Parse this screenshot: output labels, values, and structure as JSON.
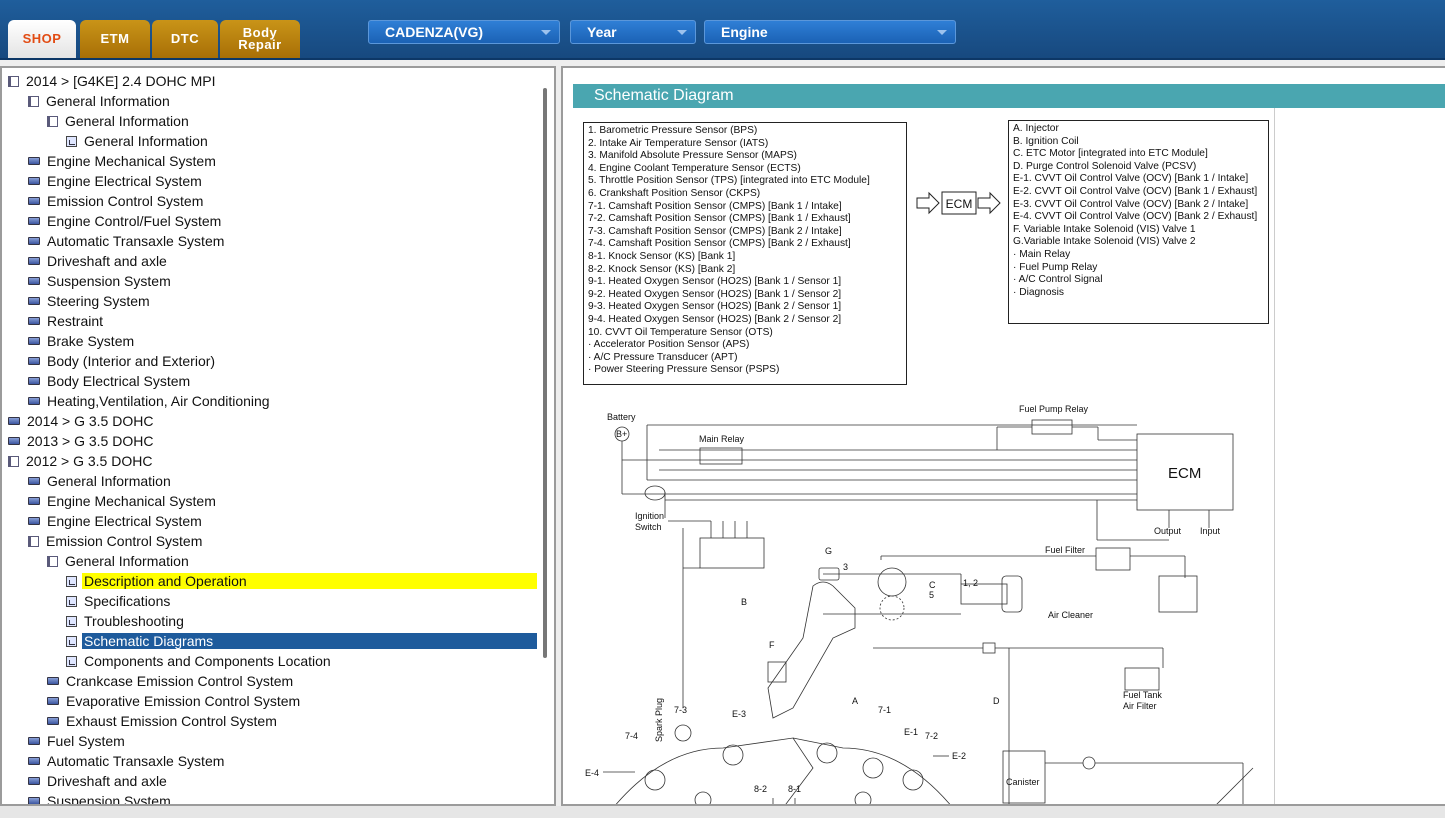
{
  "tabs": [
    {
      "label": "SHOP",
      "active": true
    },
    {
      "label": "ETM",
      "active": false
    },
    {
      "label": "DTC",
      "active": false
    },
    {
      "label": "Body\nRepair",
      "active": false
    }
  ],
  "selectors": {
    "model": "CADENZA(VG)",
    "year": "Year",
    "engine": "Engine"
  },
  "tree": [
    {
      "label": "2014 > [G4KE] 2.4 DOHC MPI",
      "icon": "book-open-icon",
      "level": 0
    },
    {
      "label": "General Information",
      "icon": "book-open-icon",
      "level": 1
    },
    {
      "label": "General Information",
      "icon": "book-open-icon",
      "level": 2
    },
    {
      "label": "General Information",
      "icon": "document-icon",
      "level": 3
    },
    {
      "label": "Engine Mechanical System",
      "icon": "book-closed-icon",
      "level": 1
    },
    {
      "label": "Engine Electrical System",
      "icon": "book-closed-icon",
      "level": 1
    },
    {
      "label": "Emission Control System",
      "icon": "book-closed-icon",
      "level": 1
    },
    {
      "label": "Engine Control/Fuel System",
      "icon": "book-closed-icon",
      "level": 1
    },
    {
      "label": "Automatic Transaxle System",
      "icon": "book-closed-icon",
      "level": 1
    },
    {
      "label": "Driveshaft and axle",
      "icon": "book-closed-icon",
      "level": 1
    },
    {
      "label": "Suspension System",
      "icon": "book-closed-icon",
      "level": 1
    },
    {
      "label": "Steering System",
      "icon": "book-closed-icon",
      "level": 1
    },
    {
      "label": "Restraint",
      "icon": "book-closed-icon",
      "level": 1
    },
    {
      "label": "Brake System",
      "icon": "book-closed-icon",
      "level": 1
    },
    {
      "label": "Body (Interior and Exterior)",
      "icon": "book-closed-icon",
      "level": 1
    },
    {
      "label": "Body Electrical System",
      "icon": "book-closed-icon",
      "level": 1
    },
    {
      "label": "Heating,Ventilation, Air Conditioning",
      "icon": "book-closed-icon",
      "level": 1
    },
    {
      "label": "2014 > G 3.5 DOHC",
      "icon": "book-closed-icon",
      "level": 0
    },
    {
      "label": "2013 > G 3.5 DOHC",
      "icon": "book-closed-icon",
      "level": 0
    },
    {
      "label": "2012 > G 3.5 DOHC",
      "icon": "book-open-icon",
      "level": 0
    },
    {
      "label": "General Information",
      "icon": "book-closed-icon",
      "level": 1
    },
    {
      "label": "Engine Mechanical System",
      "icon": "book-closed-icon",
      "level": 1
    },
    {
      "label": "Engine Electrical System",
      "icon": "book-closed-icon",
      "level": 1
    },
    {
      "label": "Emission Control System",
      "icon": "book-open-icon",
      "level": 1
    },
    {
      "label": "General Information",
      "icon": "book-open-icon",
      "level": 2
    },
    {
      "label": "Description and Operation",
      "icon": "document-icon",
      "level": 3,
      "highlight": "yellow"
    },
    {
      "label": "Specifications",
      "icon": "document-icon",
      "level": 3
    },
    {
      "label": "Troubleshooting",
      "icon": "document-icon",
      "level": 3
    },
    {
      "label": "Schematic Diagrams",
      "icon": "document-icon",
      "level": 3,
      "highlight": "selected"
    },
    {
      "label": "Components and Components Location",
      "icon": "document-icon",
      "level": 3
    },
    {
      "label": "Crankcase Emission Control System",
      "icon": "book-closed-icon",
      "level": 2
    },
    {
      "label": "Evaporative Emission Control System",
      "icon": "book-closed-icon",
      "level": 2
    },
    {
      "label": "Exhaust Emission Control System",
      "icon": "book-closed-icon",
      "level": 2
    },
    {
      "label": "Fuel System",
      "icon": "book-closed-icon",
      "level": 1
    },
    {
      "label": "Automatic Transaxle System",
      "icon": "book-closed-icon",
      "level": 1
    },
    {
      "label": "Driveshaft and axle",
      "icon": "book-closed-icon",
      "level": 1
    },
    {
      "label": "Suspension System",
      "icon": "book-closed-icon",
      "level": 1
    }
  ],
  "schematic": {
    "title": "Schematic Diagram",
    "inputs": [
      "1. Barometric Pressure Sensor (BPS)",
      "2. Intake Air Temperature Sensor (IATS)",
      "3. Manifold Absolute Pressure Sensor (MAPS)",
      "4. Engine Coolant Temperature Sensor (ECTS)",
      "5. Throttle Position Sensor (TPS) [integrated into ETC Module]",
      "6. Crankshaft Position Sensor (CKPS)",
      "7-1. Camshaft Position Sensor (CMPS) [Bank 1 / Intake]",
      "7-2. Camshaft Position Sensor (CMPS) [Bank 1 / Exhaust]",
      "7-3. Camshaft Position Sensor (CMPS) [Bank 2 / Intake]",
      "7-4. Camshaft Position Sensor (CMPS) [Bank 2 / Exhaust]",
      "8-1. Knock Sensor (KS) [Bank 1]",
      "8-2. Knock Sensor (KS) [Bank 2]",
      "9-1. Heated Oxygen Sensor (HO2S) [Bank 1 / Sensor 1]",
      "9-2. Heated Oxygen Sensor (HO2S) [Bank 1 / Sensor 2]",
      "9-3. Heated Oxygen Sensor (HO2S) [Bank 2 / Sensor 1]",
      "9-4. Heated Oxygen Sensor (HO2S) [Bank 2 / Sensor 2]",
      "10. CVVT Oil Temperature Sensor (OTS)",
      "· Accelerator Position Sensor (APS)",
      "· A/C Pressure Transducer (APT)",
      "· Power Steering Pressure Sensor (PSPS)"
    ],
    "ecm_label": "ECM",
    "outputs": [
      "A. Injector",
      "B. Ignition Coil",
      "C. ETC Motor [integrated into ETC Module]",
      "D. Purge Control Solenoid Valve (PCSV)",
      "E-1. CVVT Oil Control Valve (OCV) [Bank 1 / Intake]",
      "E-2. CVVT Oil Control Valve (OCV) [Bank 1 / Exhaust]",
      "E-3. CVVT Oil Control Valve (OCV) [Bank 2 / Intake]",
      "E-4. CVVT Oil Control Valve (OCV) [Bank 2 / Exhaust]",
      "F. Variable Intake Solenoid (VIS) Valve 1",
      "G.Variable Intake Solenoid (VIS) Valve 2",
      "· Main Relay",
      "· Fuel Pump Relay",
      "· A/C Control Signal",
      "· Diagnosis"
    ],
    "diagram_labels": {
      "battery": "Battery",
      "b_plus": "B+",
      "main_relay": "Main Relay",
      "fuel_pump_relay": "Fuel Pump Relay",
      "ecm": "ECM",
      "ignition_switch": "Ignition\nSwitch",
      "output": "Output",
      "input": "Input",
      "fuel_filter": "Fuel Filter",
      "air_cleaner": "Air Cleaner",
      "fuel_tank_air_filter": "Fuel Tank\nAir Filter",
      "canister": "Canister",
      "spark_plug": "Spark Plug",
      "g": "G",
      "three": "3",
      "b": "B",
      "c": "C",
      "five": "5",
      "one_two": "1, 2",
      "f": "F",
      "d": "D",
      "a": "A",
      "s71": "7-1",
      "s72": "7-2",
      "s73": "7-3",
      "s74": "7-4",
      "e1": "E-1",
      "e2": "E-2",
      "e3": "E-3",
      "e4": "E-4",
      "s81": "8-1",
      "s82": "8-2"
    }
  }
}
